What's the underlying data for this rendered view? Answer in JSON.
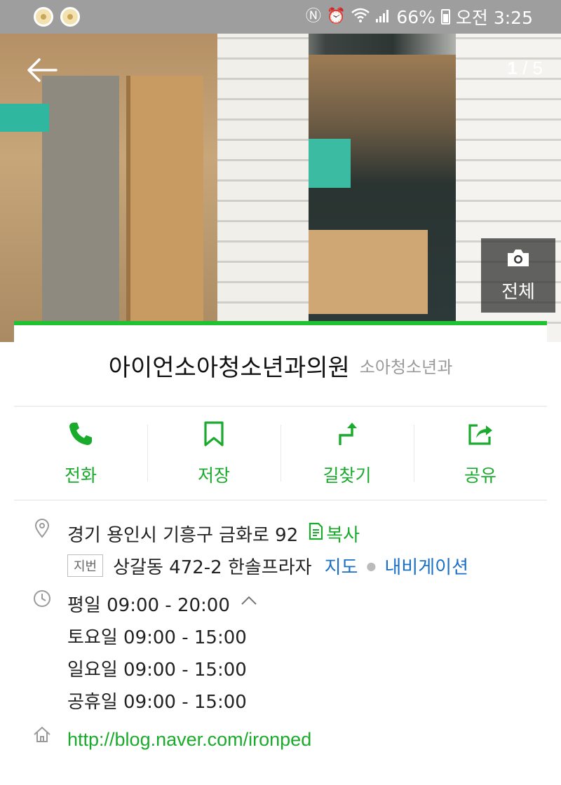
{
  "status_bar": {
    "battery": "66%",
    "time": "오전 3:25"
  },
  "gallery": {
    "current": "1",
    "total": "5",
    "separator": " / ",
    "all_photos_label": "전체"
  },
  "place": {
    "name": "아이언소아청소년과의원",
    "category": "소아청소년과"
  },
  "actions": [
    {
      "label": "전화",
      "icon": "phone-icon"
    },
    {
      "label": "저장",
      "icon": "bookmark-icon"
    },
    {
      "label": "길찾기",
      "icon": "directions-icon"
    },
    {
      "label": "공유",
      "icon": "share-icon"
    }
  ],
  "address": {
    "road": "경기 용인시 기흥구 금화로 92",
    "copy_label": "복사",
    "jibun_tag": "지번",
    "jibun": "상갈동 472-2 한솔프라자",
    "map_link": "지도",
    "navigation_link": "내비게이션"
  },
  "hours": {
    "weekday": "평일 09:00 - 20:00",
    "saturday": "토요일 09:00 - 15:00",
    "sunday": "일요일 09:00 - 15:00",
    "holiday": "공휴일 09:00 - 15:00"
  },
  "homepage": {
    "url": "http://blog.naver.com/ironped"
  },
  "colors": {
    "accent_green": "#1aab2c",
    "link_blue": "#1a70c6"
  }
}
